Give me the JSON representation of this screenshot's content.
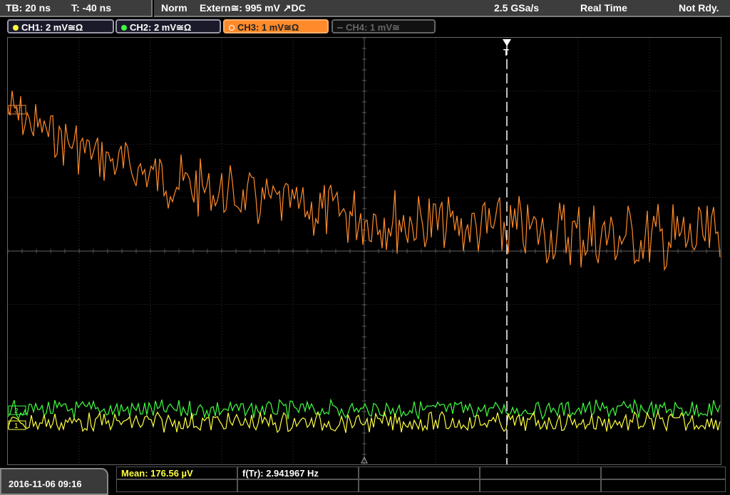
{
  "topbar": {
    "timebase": "TB: 20 ns",
    "trigger_time": "T: -40 ns",
    "mode": "Norm",
    "trigger_source": "Extern≅: 995 mV ↗DC",
    "sample_rate": "2.5 GSa/s",
    "acquisition": "Real Time",
    "status": "Not Rdy."
  },
  "channels": [
    {
      "label": "CH1: 2 mV≅Ω",
      "color": "#ffff40",
      "state": "on"
    },
    {
      "label": "CH2: 2 mV≅Ω",
      "color": "#40ff40",
      "state": "on"
    },
    {
      "label": "CH3: 1 mV≅Ω",
      "color": "#ff8a2a",
      "state": "selected"
    },
    {
      "label": "CH4: 1 mV≅",
      "color": "#777777",
      "state": "off"
    }
  ],
  "markers": {
    "trigger_label": "T",
    "ch3_marker": "3",
    "ch2_marker": "2",
    "ch1_marker": "1"
  },
  "measurements": {
    "mean": "Mean: 176.56 µV",
    "freq": "f(Tr): 2.941967 Hz"
  },
  "datetime": "2016-11-06 09:16",
  "colors": {
    "ch1": "#ffff40",
    "ch2": "#40ff40",
    "ch3": "#ff8a2a",
    "grid": "#5a5a5a"
  }
}
